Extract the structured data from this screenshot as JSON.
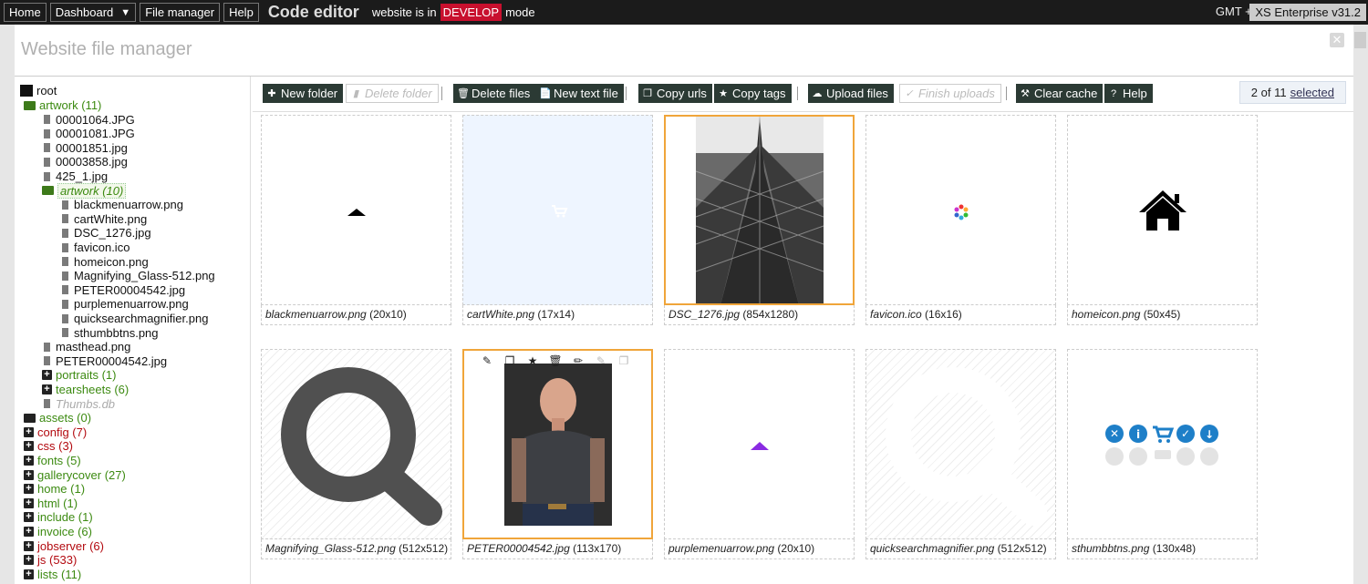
{
  "topbar": {
    "home": "Home",
    "dashboard": "Dashboard",
    "file_manager": "File manager",
    "help": "Help",
    "title": "Code editor",
    "status_pre": "website is in",
    "mode": "DEVELOP",
    "status_post": "mode",
    "timezone": "GMT +1",
    "version": "XS Enterprise v31.2"
  },
  "modal": {
    "title": "Website file manager",
    "close_icon": "close-icon"
  },
  "toolbar": {
    "new_folder": "New folder",
    "delete_folder": "Delete folder",
    "delete_files": "Delete files",
    "new_text_file": "New text file",
    "copy_urls": "Copy urls",
    "copy_tags": "Copy tags",
    "upload_files": "Upload files",
    "finish_uploads": "Finish uploads",
    "clear_cache": "Clear cache",
    "help": "Help",
    "selection_count": "2 of 11",
    "selection_label": "selected"
  },
  "tree": {
    "root": "root",
    "items": [
      {
        "label": "artwork (11)",
        "kind": "folder-open",
        "color": "green"
      },
      {
        "label": "00001064.JPG",
        "kind": "file"
      },
      {
        "label": "00001081.JPG",
        "kind": "file"
      },
      {
        "label": "00001851.jpg",
        "kind": "file"
      },
      {
        "label": "00003858.jpg",
        "kind": "file"
      },
      {
        "label": "425_1.jpg",
        "kind": "file"
      },
      {
        "label": "artwork (10)",
        "kind": "folder-open",
        "color": "green"
      },
      {
        "label": "blackmenuarrow.png",
        "kind": "file"
      },
      {
        "label": "cartWhite.png",
        "kind": "file"
      },
      {
        "label": "DSC_1276.jpg",
        "kind": "file"
      },
      {
        "label": "favicon.ico",
        "kind": "file"
      },
      {
        "label": "homeicon.png",
        "kind": "file"
      },
      {
        "label": "Magnifying_Glass-512.png",
        "kind": "file"
      },
      {
        "label": "PETER00004542.jpg",
        "kind": "file"
      },
      {
        "label": "purplemenuarrow.png",
        "kind": "file"
      },
      {
        "label": "quicksearchmagnifier.png",
        "kind": "file"
      },
      {
        "label": "sthumbbtns.png",
        "kind": "file"
      },
      {
        "label": "masthead.png",
        "kind": "file"
      },
      {
        "label": "PETER00004542.jpg",
        "kind": "file"
      },
      {
        "label": "portraits (1)",
        "kind": "plus",
        "color": "green"
      },
      {
        "label": "tearsheets (6)",
        "kind": "plus",
        "color": "green"
      },
      {
        "label": "Thumbs.db",
        "kind": "file",
        "color": "grey"
      },
      {
        "label": "assets (0)",
        "kind": "folder",
        "color": "green"
      },
      {
        "label": "config (7)",
        "kind": "plus",
        "color": "red"
      },
      {
        "label": "css (3)",
        "kind": "plus",
        "color": "red"
      },
      {
        "label": "fonts (5)",
        "kind": "plus",
        "color": "green"
      },
      {
        "label": "gallerycover (27)",
        "kind": "plus",
        "color": "green"
      },
      {
        "label": "home (1)",
        "kind": "plus",
        "color": "green"
      },
      {
        "label": "html (1)",
        "kind": "plus",
        "color": "green"
      },
      {
        "label": "include (1)",
        "kind": "plus",
        "color": "green"
      },
      {
        "label": "invoice (6)",
        "kind": "plus",
        "color": "green"
      },
      {
        "label": "jobserver (6)",
        "kind": "plus",
        "color": "red"
      },
      {
        "label": "js (533)",
        "kind": "plus",
        "color": "red"
      },
      {
        "label": "lists (11)",
        "kind": "plus",
        "color": "green"
      }
    ]
  },
  "files": [
    {
      "name": "blackmenuarrow.png",
      "dims": "(20x10)"
    },
    {
      "name": "cartWhite.png",
      "dims": "(17x14)"
    },
    {
      "name": "DSC_1276.jpg",
      "dims": "(854x1280)"
    },
    {
      "name": "favicon.ico",
      "dims": "(16x16)"
    },
    {
      "name": "homeicon.png",
      "dims": "(50x45)"
    },
    {
      "name": "Magnifying_Glass-512.png",
      "dims": "(512x512)"
    },
    {
      "name": "PETER00004542.jpg",
      "dims": "(113x170)"
    },
    {
      "name": "purplemenuarrow.png",
      "dims": "(20x10)"
    },
    {
      "name": "quicksearchmagnifier.png",
      "dims": "(512x512)"
    },
    {
      "name": "sthumbbtns.png",
      "dims": "(130x48)"
    }
  ],
  "colors": {
    "topbar": "#1b1b1b",
    "develop": "#c8102e",
    "button": "#2b3a34",
    "selected_border": "#f0a53a",
    "folder_green": "#3c8a11",
    "folder_red": "#b30a10"
  }
}
